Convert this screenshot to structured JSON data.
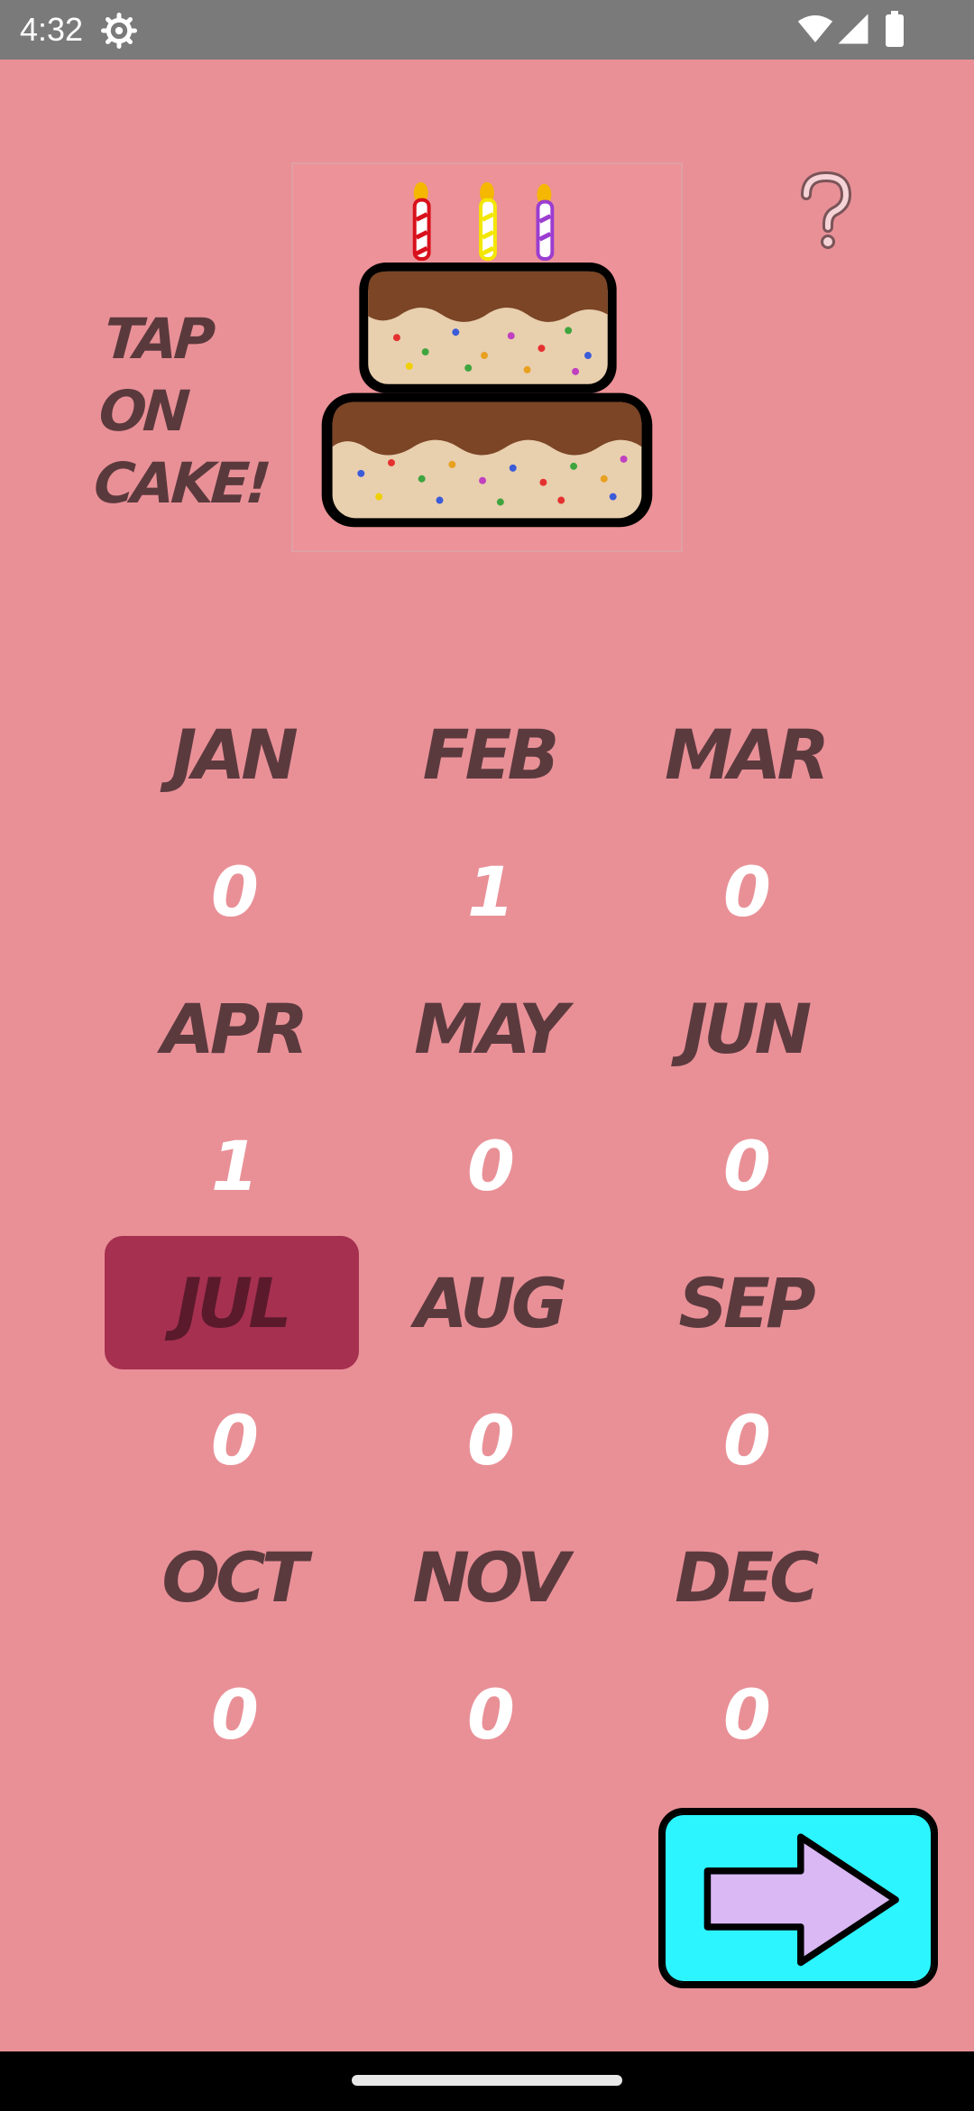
{
  "status": {
    "time": "4:32"
  },
  "header": {
    "tap_label": "TAP ON CAKE!",
    "help_symbol": "?"
  },
  "months": [
    {
      "label": "JAN",
      "count": "0"
    },
    {
      "label": "FEB",
      "count": "1"
    },
    {
      "label": "MAR",
      "count": "0"
    },
    {
      "label": "APR",
      "count": "1"
    },
    {
      "label": "MAY",
      "count": "0"
    },
    {
      "label": "JUN",
      "count": "0"
    },
    {
      "label": "JUL",
      "count": "0"
    },
    {
      "label": "AUG",
      "count": "0"
    },
    {
      "label": "SEP",
      "count": "0"
    },
    {
      "label": "OCT",
      "count": "0"
    },
    {
      "label": "NOV",
      "count": "0"
    },
    {
      "label": "DEC",
      "count": "0"
    }
  ],
  "selected_month": "JUL",
  "colors": {
    "background": "#E99097",
    "month_text": "#5B3A3E",
    "count_text": "#FFFFFF",
    "selected_bg": "#A63050",
    "next_button_bg": "#2CF5FF",
    "arrow_fill": "#D9B8F4"
  },
  "icons": {
    "status": [
      "gear-icon",
      "wifi-icon",
      "signal-icon",
      "battery-icon"
    ],
    "cake": "birthday-cake-icon",
    "help": "question-mark-icon",
    "next": "right-arrow-icon"
  }
}
